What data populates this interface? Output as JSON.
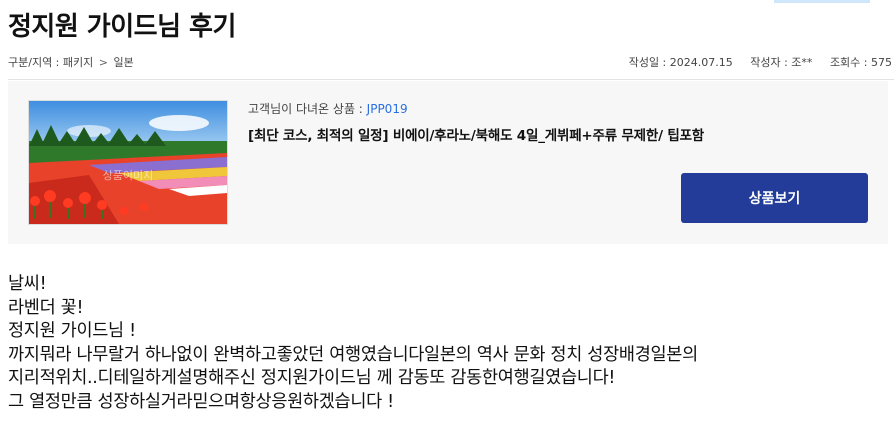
{
  "review": {
    "title": "정지원 가이드님 후기"
  },
  "breadcrumb": {
    "label": "구분/지역 : 패키지",
    "separator": ">",
    "region": "일본"
  },
  "meta": {
    "date_label": "작성일 : 2024.07.15",
    "author_label": "작성자 : 조**",
    "views_label": "조회수 : 575"
  },
  "product": {
    "code_prefix": "고객님이 다녀온 상품 : ",
    "code": "JPP019",
    "name": "[최단 코스, 최적의 일정] 비에이/후라노/북해도 4일_게뷔페+주류 무제한/ 팁포함",
    "button_label": "상품보기",
    "image_watermark": "상품이미지"
  },
  "body_lines": [
    "날씨!",
    "라벤더 꽃!",
    "정지원 가이드님 !",
    "까지뭐라 나무랄거 하나없이 완벽하고좋았던 여행였습니다일본의 역사 문화 정치 성장배경일본의",
    "지리적위치..디테일하게설명해주신 정지원가이드님 께 감동또 감동한여행길였습니다!",
    "그 열정만큼 성장하실거라믿으며항상응원하겠습니다 !"
  ],
  "colors": {
    "button_bg": "#233c9a",
    "code_color": "#2a6fe0",
    "box_bg": "#f7f7f7"
  }
}
